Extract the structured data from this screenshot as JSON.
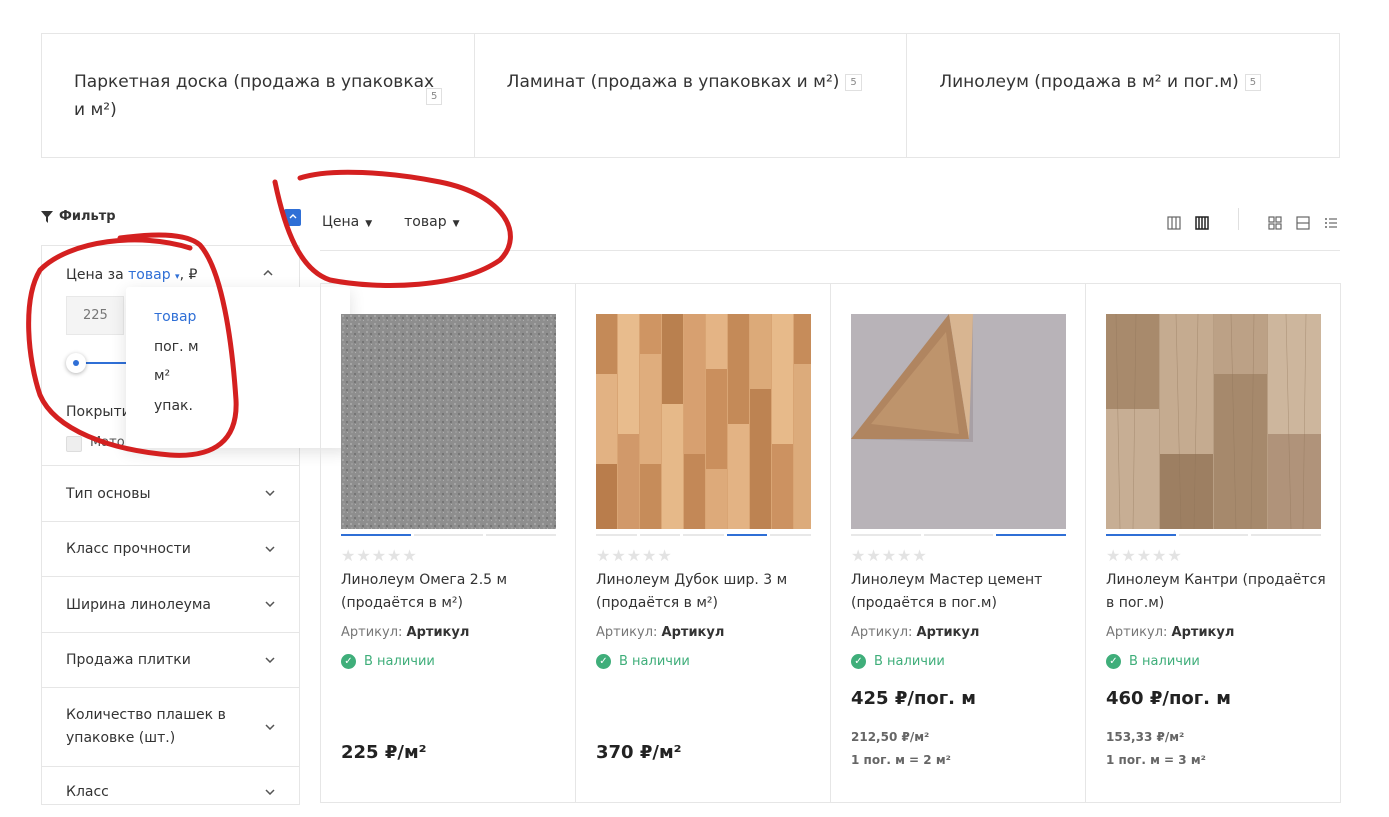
{
  "categories": [
    {
      "name": "Паркетная доска (продажа в упаковках и м²)",
      "count": "5"
    },
    {
      "name": "Ламинат (продажа в упаковках и м²)",
      "count": "5"
    },
    {
      "name": "Линолеум (продажа в м² и пог.м)",
      "count": "5"
    }
  ],
  "filter": {
    "title": "Фильтр",
    "price": {
      "prefix": "Цена за ",
      "unit_link": "товар",
      "suffix": ", ₽",
      "min_value": "225"
    },
    "unit_dropdown": [
      "товар",
      "пог. м",
      "м²",
      "упак."
    ],
    "cover_title": "Покрыти",
    "cover_option": "Мато",
    "sections": [
      "Тип основы",
      "Класс прочности",
      "Ширина линолеума",
      "Продажа плитки",
      "Количество плашек в упаковке (шт.)",
      "Класс"
    ]
  },
  "sort": {
    "price_label": "Цена",
    "unit_label": "товар"
  },
  "products": [
    {
      "name": "Линолеум Омега 2.5 м (продаётся в м²)",
      "sku_label": "Артикул:",
      "sku": "Артикул",
      "stock": "В наличии",
      "price": "225 ₽/м²"
    },
    {
      "name": "Линолеум Дубок шир. 3 м (продаётся в м²)",
      "sku_label": "Артикул:",
      "sku": "Артикул",
      "stock": "В наличии",
      "price": "370 ₽/м²"
    },
    {
      "name": "Линолеум Мастер цемент (продаётся в пог.м)",
      "sku_label": "Артикул:",
      "sku": "Артикул",
      "stock": "В наличии",
      "price": "425 ₽/пог. м",
      "price_alt": "212,50 ₽/м²",
      "conversion": "1 пог. м = 2 м²"
    },
    {
      "name": "Линолеум Кантри (продаётся в пог.м)",
      "sku_label": "Артикул:",
      "sku": "Артикул",
      "stock": "В наличии",
      "price": "460 ₽/пог. м",
      "price_alt": "153,33 ₽/м²",
      "conversion": "1 пог. м = 3 м²"
    }
  ],
  "colors": {
    "accent": "#2f6fd6",
    "stock": "#3fae7a",
    "annotation": "#d42020"
  }
}
